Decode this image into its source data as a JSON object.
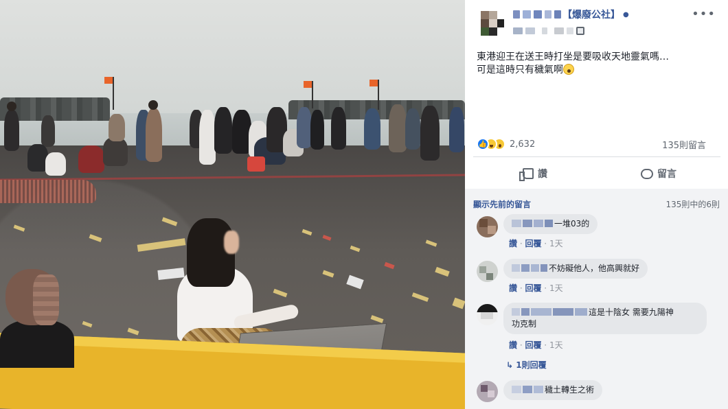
{
  "post": {
    "author": "【爆廢公社】",
    "text_line1": "東港迎王在送王時打坐是要吸收天地靈氣嗎…",
    "text_line2": "可是這時只有穢氣啊",
    "reaction_count": "2,632",
    "comment_count": "135則留言",
    "like_label": "讚",
    "comment_label": "留言"
  },
  "comments_section": {
    "show_previous": "顯示先前的留言",
    "position": "135則中的6則",
    "items": [
      {
        "text": "一堆03的",
        "like": "讚",
        "reply": "回覆",
        "time": "1天"
      },
      {
        "text": "不妨礙他人，他高興就好",
        "like": "讚",
        "reply": "回覆",
        "time": "1天"
      },
      {
        "text_line1": "這是十陰女 需要九陽神",
        "text_line2": "功克制",
        "like": "讚",
        "reply": "回覆",
        "time": "1天",
        "replies": "1則回覆"
      },
      {
        "text": "穢土轉生之術"
      }
    ]
  },
  "icons": [
    "more-icon",
    "globe-icon",
    "like-icon",
    "comment-icon",
    "reply-arrow-icon"
  ],
  "colors": {
    "link": "#385898",
    "like_reaction": "#1877f2",
    "comment_bg": "#f2f3f5"
  }
}
